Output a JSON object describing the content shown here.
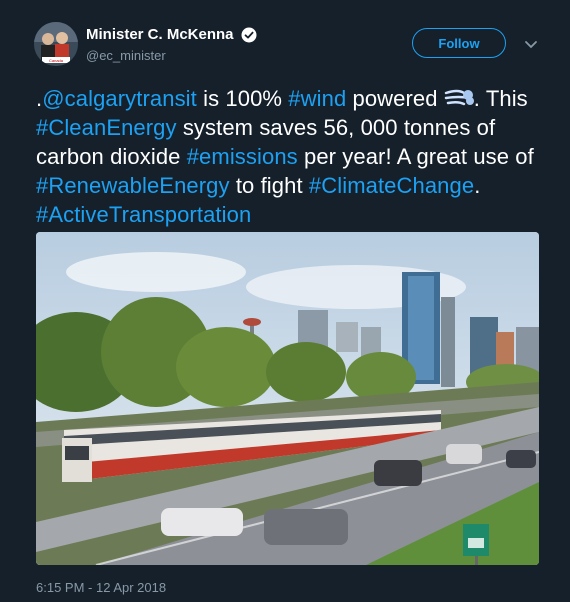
{
  "tweet": {
    "display_name": "Minister C. McKenna",
    "handle": "@ec_minister",
    "follow_label": "Follow",
    "avatar_caption": "Canada",
    "text_parts": [
      {
        "t": ".",
        "link": false
      },
      {
        "t": "@calgarytransit",
        "link": true
      },
      {
        "t": " is 100% ",
        "link": false
      },
      {
        "t": "#wind",
        "link": true
      },
      {
        "t": " powered ",
        "link": false
      },
      {
        "t": ". This ",
        "link": false
      },
      {
        "t": "#CleanEnergy",
        "link": true
      },
      {
        "t": " system saves 56, 000 tonnes of carbon dioxide ",
        "link": false
      },
      {
        "t": "#emissions",
        "link": true
      },
      {
        "t": " per year! A great use of ",
        "link": false
      },
      {
        "t": "#RenewableEnergy",
        "link": true
      },
      {
        "t": " to fight ",
        "link": false
      },
      {
        "t": "#ClimateChange",
        "link": true
      },
      {
        "t": ". ",
        "link": false
      },
      {
        "t": "#ActiveTransportation",
        "link": true
      }
    ],
    "emoji_icon": "wind-face-emoji",
    "timestamp": "6:15 PM - 12 Apr 2018"
  },
  "colors": {
    "background": "#15202b",
    "link": "#1da1f2",
    "secondary_text": "#8899a6"
  },
  "media": {
    "alt": "Calgary C-Train light rail beside a highway with the downtown skyline behind",
    "sign_text": ""
  }
}
